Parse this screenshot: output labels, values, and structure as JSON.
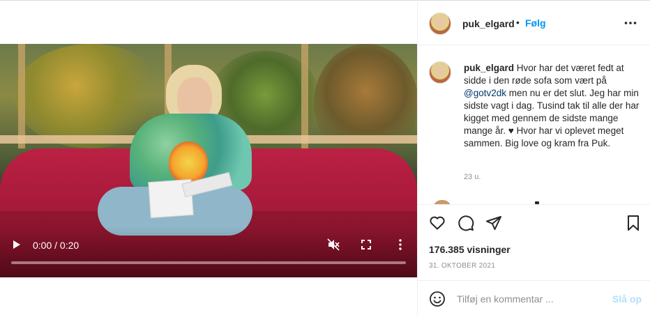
{
  "post": {
    "username": "puk_elgard",
    "dot": "•",
    "follow_label": "Følg",
    "caption_user": "puk_elgard",
    "caption_before_mention": " Hvor har det været fedt at sidde i den røde sofa som vært på ",
    "caption_mention": "@gotv2dk",
    "caption_after_mention": " men nu er det slut. Jeg har min sidste vagt i dag. Tusind tak til alle der har kigget med gennem de sidste mange mange år. ♥ Hvor har vi oplevet meget sammen. Big love og kram fra Puk.",
    "time_ago": "23 u.",
    "views": "176.385 visninger",
    "date": "31. OKTOBER 2021"
  },
  "video": {
    "time_display": "0:00 / 0:20",
    "progress_fraction": 0.0
  },
  "comment_box": {
    "placeholder": "Tilføj en kommentar ...",
    "post_label": "Slå op"
  },
  "icons": {
    "header_more": "more-horizontal-icon",
    "like": "heart-icon",
    "comment": "comment-bubble-icon",
    "share": "paper-plane-icon",
    "save": "bookmark-icon",
    "emoji": "emoji-smiley-icon",
    "play": "play-icon",
    "mute": "muted-speaker-icon",
    "fullscreen": "fullscreen-icon",
    "video_more": "more-vertical-icon"
  },
  "colors": {
    "accent_blue": "#0095f6",
    "post_disabled": "#b2dffc",
    "mention": "#00376b",
    "muted_text": "#8e8e8e"
  }
}
